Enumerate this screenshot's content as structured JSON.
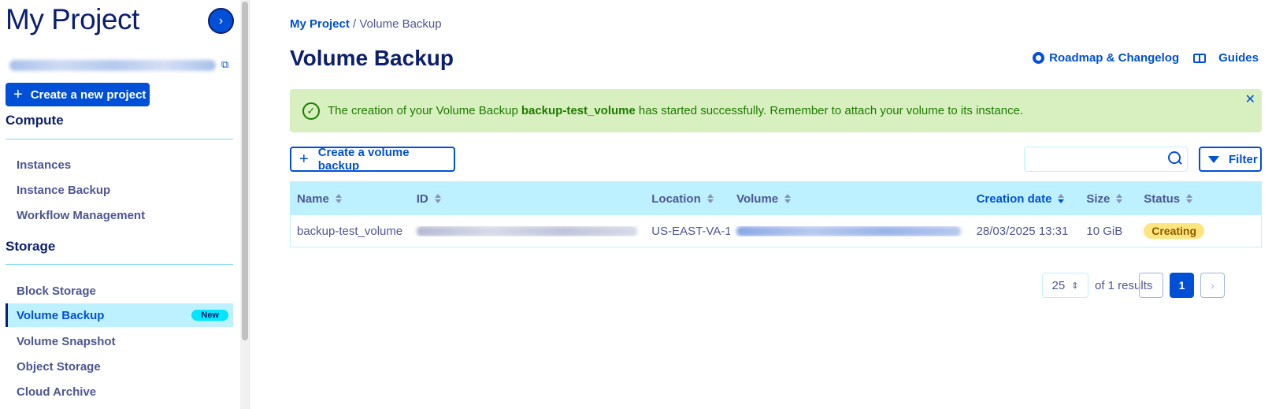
{
  "sidebar": {
    "project_title": "My Project",
    "collapse_icon": "chevron-right-icon",
    "create_project_label": "Create a new project",
    "sections": [
      {
        "title": "Compute",
        "items": [
          "Instances",
          "Instance Backup",
          "Workflow Management"
        ]
      },
      {
        "title": "Storage",
        "items": [
          "Block Storage",
          "Volume Backup",
          "Volume Snapshot",
          "Object Storage",
          "Cloud Archive"
        ]
      }
    ],
    "active_item": "Volume Backup",
    "new_badge": "New"
  },
  "header": {
    "breadcrumb_root": "My Project",
    "breadcrumb_sep": "/",
    "breadcrumb_current": "Volume Backup",
    "title": "Volume Backup",
    "roadmap_label": "Roadmap & Changelog",
    "guides_label": "Guides"
  },
  "alert": {
    "text_before": "The creation of your Volume Backup",
    "name": "backup-test_volume",
    "text_after": "has started successfully. Remember to attach your volume to its instance."
  },
  "toolbar": {
    "create_label": "Create a volume backup",
    "search_placeholder": "",
    "filter_label": "Filter"
  },
  "table": {
    "columns": [
      "Name",
      "ID",
      "Location",
      "Volume",
      "Creation date",
      "Size",
      "Status"
    ],
    "rows": [
      {
        "name": "backup-test_volume",
        "location": "US-EAST-VA-1",
        "creation_date": "28/03/2025 13:31",
        "size": "10 GiB",
        "status": "Creating"
      }
    ]
  },
  "pagination": {
    "page_size": "25",
    "results_text": "of 1 results",
    "current_page": "1"
  },
  "colors": {
    "primary": "#0050d7",
    "navy": "#0b1f6e",
    "header_bg": "#bef1ff",
    "success_bg": "#d8f0bf",
    "status_creating": "#ffe57f"
  }
}
